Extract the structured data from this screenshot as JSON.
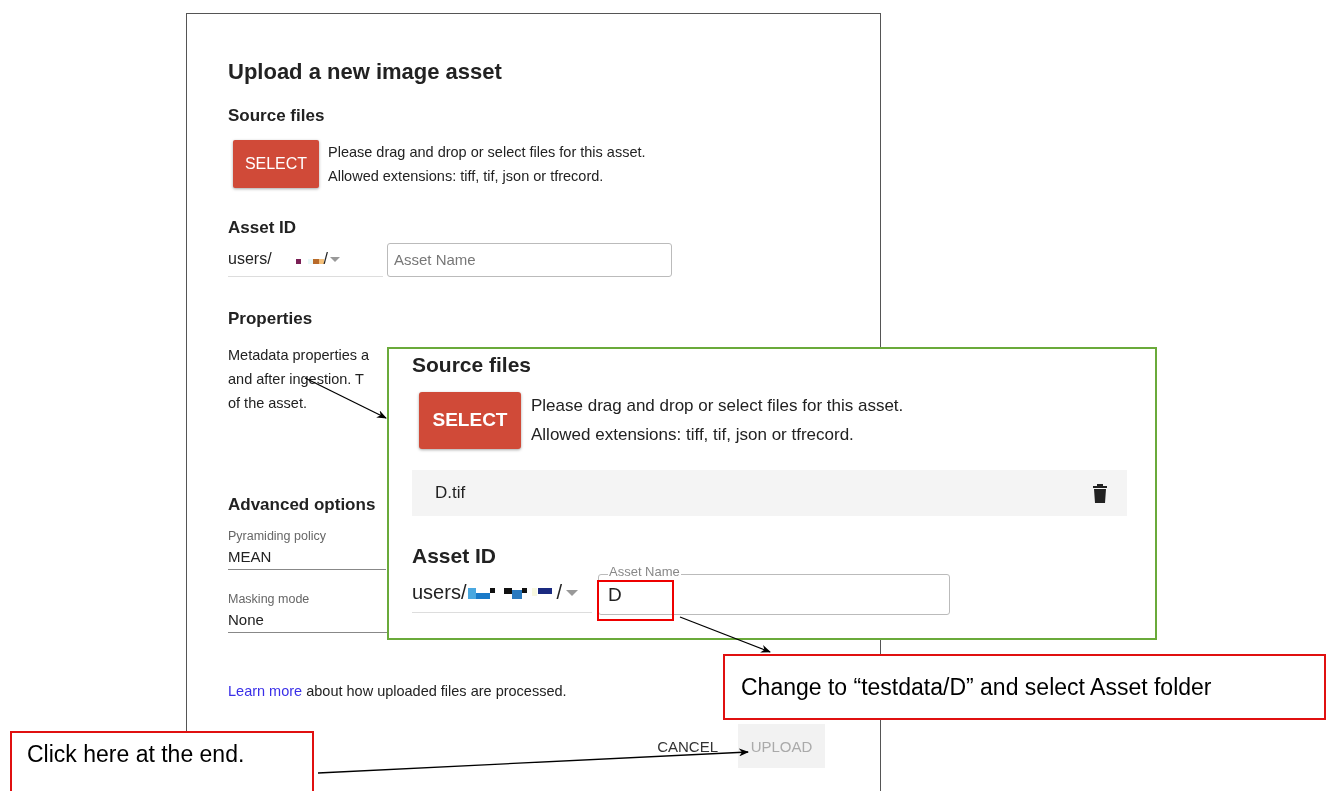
{
  "dialog": {
    "title": "Upload a new image asset",
    "source_files": {
      "heading": "Source files",
      "button": "SELECT",
      "hint_lines": [
        "Please drag and drop or select files for this asset.",
        "Allowed extensions: tiff, tif, json or tfrecord."
      ]
    },
    "asset_id": {
      "heading": "Asset ID",
      "prefix": "users/",
      "suffix": "/",
      "name_placeholder": "Asset Name"
    },
    "properties": {
      "heading": "Properties",
      "description_lines": [
        "Metadata properties a",
        "and after ingestion. T",
        "of the asset."
      ]
    },
    "advanced_options": {
      "heading": "Advanced options",
      "fields": [
        {
          "label": "Pyramiding policy",
          "value": "MEAN"
        },
        {
          "label": "Masking mode",
          "value": "None"
        }
      ]
    },
    "learn_more": {
      "link": "Learn more",
      "text": "about how uploaded files are processed."
    },
    "buttons": [
      {
        "label": "CANCEL",
        "disabled": false
      },
      {
        "label": "UPLOAD",
        "disabled": true
      }
    ]
  },
  "zoom_inset": {
    "heading": "Source files",
    "button": "SELECT",
    "hint_lines": [
      "Please drag and drop or select files for this asset.",
      "Allowed extensions: tiff, tif, json or tfrecord."
    ],
    "files": [
      {
        "name": "D.tif"
      }
    ],
    "asset_id_heading": "Asset ID",
    "prefix": "users/",
    "suffix": "/",
    "name_label": "Asset Name",
    "name_value": "D"
  },
  "callouts": [
    {
      "kind": "right",
      "text": "Change to “testdata/D” and select Asset folder"
    },
    {
      "kind": "left",
      "text": "Click here at the end."
    }
  ]
}
